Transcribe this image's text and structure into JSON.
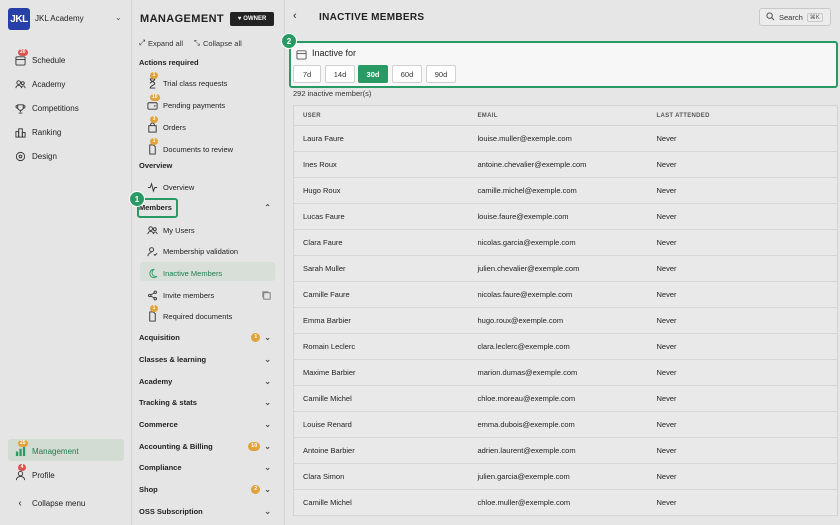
{
  "rail": {
    "logo_text": "JKL",
    "academy": "JKL Academy",
    "items": [
      {
        "label": "Schedule",
        "badge": "20"
      },
      {
        "label": "Academy",
        "badge": ""
      },
      {
        "label": "Competitions",
        "badge": ""
      },
      {
        "label": "Ranking",
        "badge": ""
      },
      {
        "label": "Design",
        "badge": ""
      }
    ],
    "management": {
      "label": "Management",
      "badge": "25"
    },
    "profile": {
      "label": "Profile",
      "badge": "4"
    },
    "collapse": "Collapse menu"
  },
  "panel": {
    "title": "MANAGEMENT",
    "owner": "OWNER",
    "expand_all": "Expand all",
    "collapse_all": "Collapse all",
    "actions_title": "Actions required",
    "actions": [
      {
        "label": "Trial class requests",
        "badge": "1"
      },
      {
        "label": "Pending payments",
        "badge": "10"
      },
      {
        "label": "Orders",
        "badge": "3"
      },
      {
        "label": "Documents to review",
        "badge": "1"
      }
    ],
    "overview_title": "Overview",
    "overview_item": "Overview",
    "members_title": "Members",
    "members_items": [
      "My Users",
      "Membership validation",
      "Inactive Members",
      "Invite members"
    ],
    "required_docs": {
      "label": "Required documents",
      "badge": "1"
    },
    "sections": [
      {
        "label": "Acquisition",
        "badge": "1"
      },
      {
        "label": "Classes & learning",
        "badge": ""
      },
      {
        "label": "Academy",
        "badge": ""
      },
      {
        "label": "Tracking & stats",
        "badge": ""
      },
      {
        "label": "Commerce",
        "badge": ""
      },
      {
        "label": "Accounting & Billing",
        "badge": "10"
      },
      {
        "label": "Compliance",
        "badge": ""
      },
      {
        "label": "Shop",
        "badge": "2"
      },
      {
        "label": "OSS Subscription",
        "badge": ""
      }
    ]
  },
  "steps": {
    "one": "1",
    "two": "2"
  },
  "main": {
    "title": "INACTIVE MEMBERS",
    "search": "Search",
    "shortcut": "⌘K",
    "filter_title": "Inactive for",
    "filter_options": [
      "7d",
      "14d",
      "30d",
      "60d",
      "90d"
    ],
    "filter_selected": "30d",
    "count": "292 inactive member(s)",
    "columns": [
      "USER",
      "EMAIL",
      "LAST ATTENDED"
    ],
    "rows": [
      [
        "Laura Faure",
        "louise.muller@exemple.com",
        "Never"
      ],
      [
        "Ines Roux",
        "antoine.chevalier@exemple.com",
        "Never"
      ],
      [
        "Hugo Roux",
        "camille.michel@exemple.com",
        "Never"
      ],
      [
        "Lucas Faure",
        "louise.faure@exemple.com",
        "Never"
      ],
      [
        "Clara Faure",
        "nicolas.garcia@exemple.com",
        "Never"
      ],
      [
        "Sarah Muller",
        "julien.chevalier@exemple.com",
        "Never"
      ],
      [
        "Camille Faure",
        "nicolas.faure@exemple.com",
        "Never"
      ],
      [
        "Emma Barbier",
        "hugo.roux@exemple.com",
        "Never"
      ],
      [
        "Romain Leclerc",
        "clara.leclerc@exemple.com",
        "Never"
      ],
      [
        "Maxime Barbier",
        "marion.dumas@exemple.com",
        "Never"
      ],
      [
        "Camille Michel",
        "chloe.moreau@exemple.com",
        "Never"
      ],
      [
        "Louise Renard",
        "emma.dubois@exemple.com",
        "Never"
      ],
      [
        "Antoine Barbier",
        "adrien.laurent@exemple.com",
        "Never"
      ],
      [
        "Clara Simon",
        "julien.garcia@exemple.com",
        "Never"
      ],
      [
        "Camille Michel",
        "chloe.muller@exemple.com",
        "Never"
      ]
    ]
  }
}
